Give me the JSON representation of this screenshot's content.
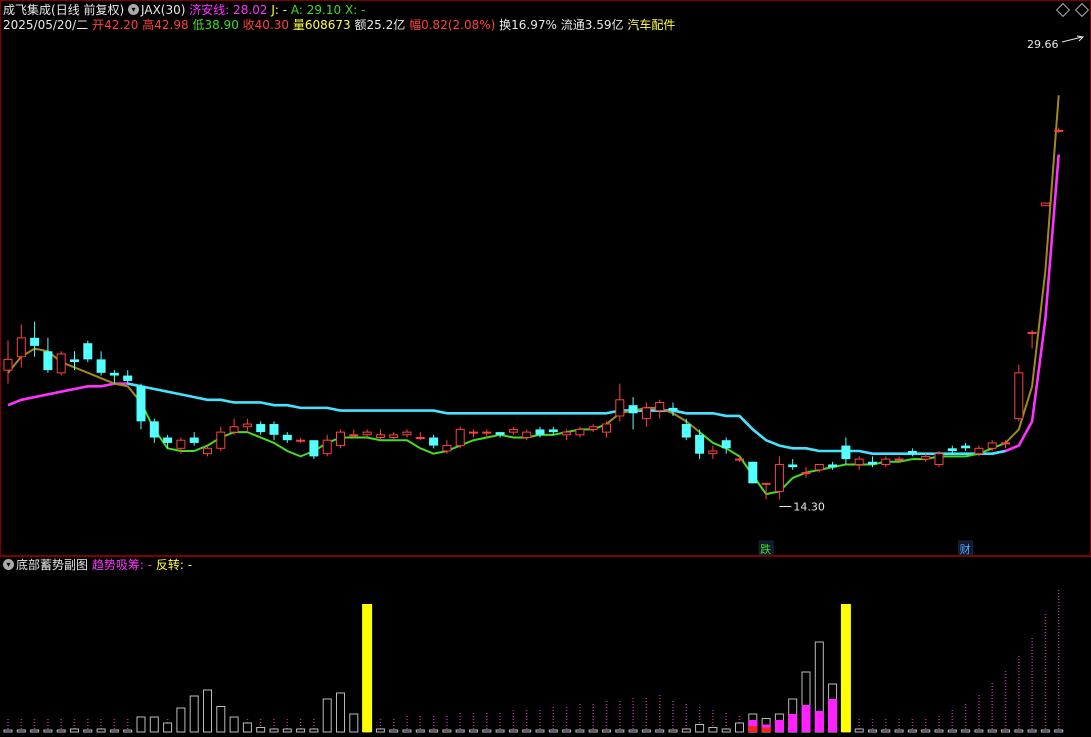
{
  "header": {
    "stock_name": "成飞集成",
    "period": "(日线 前复权)",
    "indicator_name": "JAX(30)",
    "jax_label": "济安线:",
    "jax_value": "28.02",
    "j_label": "J:",
    "j_value": "-",
    "a_label": "A:",
    "a_value": "29.10",
    "x_label": "X:",
    "x_value": "-"
  },
  "info": {
    "date": "2025/05/20/二",
    "open_label": "开",
    "open": "42.20",
    "high_label": "高",
    "high": "42.98",
    "low_label": "低",
    "low": "38.90",
    "close_label": "收",
    "close": "40.30",
    "volume_label": "量",
    "volume": "608673",
    "amount_label": "额",
    "amount": "25.2亿",
    "change_label": "幅",
    "change": "0.82(2.08%)",
    "turnover_label": "换",
    "turnover": "16.97%",
    "float_label": "流通",
    "float_cap": "3.59亿",
    "industry": "汽车配件"
  },
  "sub_panel": {
    "title": "底部蓄势副图",
    "trend_label": "趋势吸筹:",
    "trend_value": "-",
    "reverse_label": "反转:",
    "reverse_value": "-"
  },
  "colors": {
    "up": "#ff4040",
    "down": "#54ffff",
    "jax_line": "#ff33ff",
    "ma_cyan": "#44e4ff",
    "ma_green": "#44dd22",
    "ma_olive": "#a08a1c",
    "yellow": "#ffff00",
    "magenta": "#ff22ff"
  },
  "chart_data": [
    {
      "type": "candlestick",
      "title": "",
      "max_label": "29.66",
      "min_label": "14.30",
      "ylim": [
        12.5,
        31.5
      ],
      "markers": [
        {
          "x": 57,
          "text": "跌",
          "color": "#44dd22"
        },
        {
          "x": 72,
          "text": "财",
          "color": "#54a8ff"
        }
      ],
      "candles": [
        [
          19.1,
          20.2,
          18.6,
          19.5
        ],
        [
          19.6,
          20.8,
          19.2,
          20.3
        ],
        [
          20.3,
          20.9,
          19.6,
          20.0
        ],
        [
          19.8,
          20.3,
          19.0,
          19.1
        ],
        [
          19.0,
          19.8,
          18.9,
          19.7
        ],
        [
          19.5,
          19.8,
          19.1,
          19.4
        ],
        [
          20.1,
          20.2,
          19.4,
          19.5
        ],
        [
          19.5,
          19.8,
          18.9,
          19.0
        ],
        [
          19.0,
          19.1,
          18.6,
          18.9
        ],
        [
          18.9,
          19.1,
          18.6,
          18.7
        ],
        [
          18.5,
          18.6,
          16.9,
          17.2
        ],
        [
          17.2,
          17.3,
          16.4,
          16.6
        ],
        [
          16.6,
          16.7,
          16.2,
          16.4
        ],
        [
          16.2,
          16.6,
          16.0,
          16.5
        ],
        [
          16.6,
          16.8,
          16.3,
          16.4
        ],
        [
          16.0,
          16.3,
          15.9,
          16.2
        ],
        [
          16.2,
          17.0,
          16.1,
          16.8
        ],
        [
          16.8,
          17.3,
          16.7,
          17.0
        ],
        [
          17.0,
          17.3,
          16.8,
          17.1
        ],
        [
          17.1,
          17.2,
          16.7,
          16.8
        ],
        [
          17.1,
          17.2,
          16.5,
          16.7
        ],
        [
          16.7,
          16.8,
          16.4,
          16.5
        ],
        [
          16.5,
          16.6,
          16.4,
          16.5
        ],
        [
          16.5,
          16.5,
          15.8,
          15.9
        ],
        [
          16.0,
          16.7,
          15.9,
          16.5
        ],
        [
          16.3,
          16.9,
          16.2,
          16.8
        ],
        [
          16.7,
          16.9,
          16.6,
          16.7
        ],
        [
          16.7,
          16.9,
          16.6,
          16.8
        ],
        [
          16.6,
          16.9,
          16.5,
          16.7
        ],
        [
          16.6,
          16.8,
          16.5,
          16.7
        ],
        [
          16.7,
          16.9,
          16.6,
          16.8
        ],
        [
          16.6,
          16.8,
          16.5,
          16.6
        ],
        [
          16.6,
          16.7,
          16.2,
          16.3
        ],
        [
          16.1,
          16.5,
          16.0,
          16.3
        ],
        [
          16.3,
          17.0,
          16.2,
          16.9
        ],
        [
          16.8,
          16.9,
          16.6,
          16.8
        ],
        [
          16.8,
          16.9,
          16.6,
          16.8
        ],
        [
          16.8,
          16.8,
          16.6,
          16.7
        ],
        [
          16.8,
          17.0,
          16.7,
          16.9
        ],
        [
          16.6,
          16.9,
          16.5,
          16.8
        ],
        [
          16.9,
          17.0,
          16.6,
          16.7
        ],
        [
          16.9,
          17.0,
          16.7,
          16.8
        ],
        [
          16.7,
          16.9,
          16.5,
          16.8
        ],
        [
          16.7,
          17.0,
          16.6,
          16.9
        ],
        [
          16.9,
          17.1,
          16.8,
          17.0
        ],
        [
          16.8,
          17.2,
          16.6,
          17.1
        ],
        [
          17.4,
          18.6,
          17.2,
          18.0
        ],
        [
          17.8,
          18.1,
          16.9,
          17.5
        ],
        [
          17.3,
          17.9,
          17.0,
          17.7
        ],
        [
          17.6,
          18.0,
          17.3,
          17.9
        ],
        [
          17.7,
          17.9,
          17.4,
          17.6
        ],
        [
          17.1,
          17.3,
          16.5,
          16.6
        ],
        [
          16.7,
          16.9,
          15.8,
          16.0
        ],
        [
          16.0,
          16.3,
          15.8,
          16.1
        ],
        [
          16.5,
          16.6,
          16.0,
          16.2
        ],
        [
          15.8,
          15.9,
          15.7,
          15.8
        ],
        [
          15.7,
          15.7,
          14.9,
          14.9
        ],
        [
          14.9,
          14.9,
          14.3,
          14.9
        ],
        [
          14.6,
          15.9,
          14.3,
          15.6
        ],
        [
          15.6,
          15.8,
          15.4,
          15.5
        ],
        [
          15.3,
          15.5,
          15.1,
          15.3
        ],
        [
          15.4,
          15.6,
          15.3,
          15.6
        ],
        [
          15.6,
          15.7,
          15.4,
          15.5
        ],
        [
          16.3,
          16.6,
          15.6,
          15.8
        ],
        [
          15.6,
          15.9,
          15.4,
          15.8
        ],
        [
          15.7,
          15.9,
          15.5,
          15.6
        ],
        [
          15.6,
          15.9,
          15.5,
          15.8
        ],
        [
          15.8,
          15.9,
          15.7,
          15.8
        ],
        [
          16.1,
          16.2,
          15.9,
          16.0
        ],
        [
          15.8,
          16.0,
          15.7,
          15.9
        ],
        [
          15.6,
          16.1,
          15.5,
          16.0
        ],
        [
          16.2,
          16.3,
          16.0,
          16.1
        ],
        [
          16.3,
          16.4,
          16.1,
          16.2
        ],
        [
          16.0,
          16.3,
          15.9,
          16.2
        ],
        [
          16.2,
          16.5,
          16.1,
          16.4
        ],
        [
          16.4,
          16.5,
          16.2,
          16.4
        ],
        [
          17.3,
          19.3,
          17.2,
          19.0
        ],
        [
          20.5,
          20.6,
          19.9,
          20.5
        ],
        [
          25.2,
          25.3,
          25.2,
          25.3
        ],
        [
          28.0,
          28.1,
          27.9,
          28.0
        ]
      ],
      "jax_line": [
        17.8,
        18.0,
        18.1,
        18.2,
        18.3,
        18.4,
        18.5,
        18.5,
        18.6,
        18.6,
        18.5,
        18.4,
        18.3,
        18.2,
        18.1,
        18.0,
        18.0,
        17.9,
        17.9,
        17.9,
        17.8,
        17.8,
        17.7,
        17.7,
        17.7,
        17.6,
        17.6,
        17.6,
        17.6,
        17.6,
        17.6,
        17.6,
        17.6,
        17.5,
        17.5,
        17.5,
        17.5,
        17.5,
        17.5,
        17.5,
        17.5,
        17.5,
        17.5,
        17.5,
        17.5,
        17.5,
        17.6,
        17.6,
        17.6,
        17.6,
        17.6,
        17.5,
        17.5,
        17.5,
        17.4,
        17.4,
        16.9,
        16.5,
        16.3,
        16.2,
        16.2,
        16.1,
        16.1,
        16.1,
        16.1,
        16.0,
        16.0,
        16.0,
        16.0,
        16.0,
        16.0,
        16.0,
        16.0,
        16.0,
        16.0,
        16.1,
        16.3,
        17.2,
        21.0,
        27.1
      ],
      "ma_green": [
        19.0,
        19.6,
        19.9,
        19.8,
        19.4,
        19.2,
        19.0,
        18.8,
        18.6,
        18.5,
        17.9,
        16.9,
        16.2,
        16.1,
        16.1,
        16.3,
        16.6,
        16.8,
        16.8,
        16.6,
        16.4,
        16.1,
        15.9,
        16.1,
        16.4,
        16.6,
        16.6,
        16.6,
        16.5,
        16.5,
        16.5,
        16.2,
        16.0,
        16.1,
        16.3,
        16.5,
        16.6,
        16.7,
        16.6,
        16.6,
        16.7,
        16.7,
        16.8,
        16.9,
        16.9,
        17.1,
        17.5,
        17.6,
        17.7,
        17.7,
        17.5,
        17.2,
        16.8,
        16.4,
        16.2,
        15.9,
        15.2,
        14.5,
        14.6,
        15.1,
        15.3,
        15.4,
        15.5,
        15.6,
        15.6,
        15.6,
        15.7,
        15.7,
        15.8,
        15.8,
        15.9,
        15.9,
        15.9,
        16.0,
        16.2,
        16.4,
        16.9,
        18.5,
        22.8,
        29.3
      ]
    },
    {
      "type": "bar",
      "title": "底部蓄势副图",
      "series": [
        {
          "name": "趋势吸筹",
          "values": [
            0,
            0,
            0,
            0,
            0,
            0,
            0,
            0,
            0,
            0,
            0,
            0,
            0,
            0,
            0,
            0,
            0,
            0,
            0,
            0,
            0,
            0,
            0,
            0,
            0,
            0,
            0,
            0,
            0,
            0,
            0,
            0,
            0,
            0,
            0,
            0,
            0,
            0,
            0,
            0,
            0,
            0,
            0,
            0,
            0,
            0,
            0,
            0,
            0,
            0,
            0,
            0,
            0,
            0,
            0,
            0,
            0.08,
            0.05,
            0.08,
            0.12,
            0.18,
            0.14,
            0.22,
            0,
            0,
            0,
            0,
            0,
            0,
            0,
            0,
            0,
            0,
            0,
            0,
            0,
            0,
            0,
            0,
            0
          ]
        },
        {
          "name": "反转",
          "values": [
            0,
            0,
            0,
            0,
            0,
            0,
            0,
            0,
            0,
            0,
            0,
            0,
            0,
            0,
            0,
            0,
            0,
            0,
            0,
            0,
            0,
            0,
            0,
            0,
            0,
            0,
            0,
            0,
            0,
            0,
            0,
            0,
            0,
            0,
            0,
            0,
            0,
            0,
            0,
            0,
            0,
            0,
            0,
            0,
            0,
            0,
            0,
            0,
            0,
            0,
            0,
            0,
            0,
            0,
            0,
            0,
            0.04,
            0.03,
            0,
            0,
            0,
            0,
            0,
            0,
            0,
            0,
            0,
            0,
            0,
            0,
            0,
            0,
            0,
            0,
            0,
            0,
            0,
            0,
            0,
            0
          ]
        }
      ],
      "hollow_bars": [
        0.01,
        0.01,
        0.01,
        0.01,
        0.01,
        0.02,
        0.01,
        0.02,
        0.01,
        0.01,
        0.1,
        0.1,
        0.06,
        0.16,
        0.24,
        0.28,
        0.17,
        0.1,
        0.06,
        0.03,
        0.02,
        0.02,
        0.02,
        0.02,
        0.22,
        0.26,
        0.12,
        0.02,
        0.02,
        0.01,
        0.01,
        0.01,
        0.01,
        0.01,
        0.01,
        0.01,
        0.01,
        0.01,
        0.01,
        0.01,
        0.01,
        0.01,
        0.01,
        0.01,
        0.01,
        0.01,
        0.01,
        0.01,
        0.01,
        0.01,
        0.01,
        0.02,
        0.05,
        0.03,
        0.02,
        0.06,
        0.12,
        0.09,
        0.12,
        0.22,
        0.4,
        0.6,
        0.32,
        0.1,
        0.02,
        0.01,
        0.01,
        0.01,
        0.01,
        0.01,
        0.01,
        0.01,
        0.01,
        0.01,
        0.01,
        0.01,
        0.01,
        0.01,
        0.01,
        0.01
      ],
      "yellow_bars": [
        27,
        63
      ],
      "dotted_levels": [
        0.1,
        0.1,
        0.1,
        0.1,
        0.1,
        0.1,
        0.1,
        0.1,
        0.1,
        0.1,
        0.1,
        0.1,
        0.1,
        0.1,
        0.1,
        0.1,
        0.1,
        0.1,
        0.1,
        0.1,
        0.1,
        0.1,
        0.1,
        0.1,
        0.1,
        0.1,
        0.1,
        0.1,
        0.1,
        0.1,
        0.11,
        0.11,
        0.12,
        0.12,
        0.13,
        0.13,
        0.14,
        0.14,
        0.15,
        0.16,
        0.16,
        0.17,
        0.18,
        0.19,
        0.2,
        0.21,
        0.22,
        0.23,
        0.24,
        0.25,
        0.22,
        0.2,
        0.18,
        0.16,
        0.14,
        0.12,
        0.1,
        0.1,
        0.1,
        0.1,
        0.1,
        0.1,
        0.1,
        0.1,
        0.1,
        0.1,
        0.1,
        0.1,
        0.1,
        0.1,
        0.12,
        0.15,
        0.2,
        0.26,
        0.33,
        0.42,
        0.52,
        0.64,
        0.8,
        0.95
      ]
    }
  ]
}
